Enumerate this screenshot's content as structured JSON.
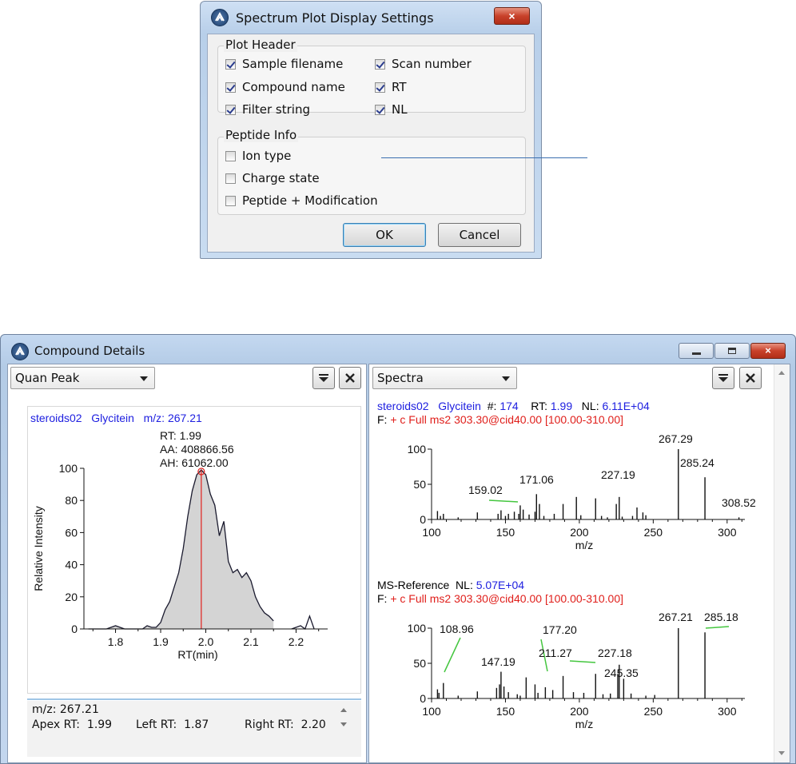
{
  "dialog": {
    "title": "Spectrum Plot Display Settings",
    "close_label": "×",
    "plot_header": {
      "label": "Plot Header",
      "items": [
        {
          "label": "Sample filename",
          "checked": true
        },
        {
          "label": "Scan number",
          "checked": true
        },
        {
          "label": "Compound name",
          "checked": true
        },
        {
          "label": "RT",
          "checked": true
        },
        {
          "label": "Filter string",
          "checked": true
        },
        {
          "label": "NL",
          "checked": true
        }
      ]
    },
    "peptide_info": {
      "label": "Peptide Info",
      "items": [
        {
          "label": "Ion type",
          "checked": false
        },
        {
          "label": "Charge state",
          "checked": false
        },
        {
          "label": "Peptide + Modification",
          "checked": false
        }
      ]
    },
    "ok_label": "OK",
    "cancel_label": "Cancel"
  },
  "window": {
    "title": "Compound Details",
    "left_pane": {
      "combo": "Quan Peak",
      "header": {
        "sample": "steroids02",
        "compound": "Glycitein",
        "mz_label": "m/z: 267.21"
      },
      "peak_labels": [
        "RT: 1.99",
        "AA: 408866.56",
        "AH: 61062.00"
      ],
      "footer": {
        "mz": "m/z: 267.21",
        "apex": "Apex RT:  1.99",
        "left": "Left RT:  1.87",
        "right": "Right RT:  2.20"
      }
    },
    "right_pane": {
      "combo": "Spectra",
      "header1": {
        "sample": "steroids02",
        "compound": "Glycitein",
        "scan_key": "#:",
        "scan": "174",
        "rt_key": "RT:",
        "rt": "1.99",
        "nl_key": "NL:",
        "nl": "6.11E+04"
      },
      "filter1": {
        "key": "F:",
        "value": "+ c Full ms2 303.30@cid40.00 [100.00-310.00]"
      },
      "header2": {
        "label": "MS-Reference",
        "nl_key": "NL:",
        "nl": "5.07E+04"
      },
      "filter2": {
        "key": "F:",
        "value": "+ c Full ms2 303.30@cid40.00 [100.00-310.00]"
      }
    }
  },
  "chart_data": [
    {
      "type": "area",
      "xlabel": "RT(min)",
      "ylabel": "Relative Intensity",
      "xlim": [
        1.73,
        2.27
      ],
      "ylim": [
        0,
        100
      ],
      "xticks": [
        1.8,
        1.9,
        2.0,
        2.1,
        2.2
      ],
      "yticks": [
        0,
        20,
        40,
        60,
        80,
        100
      ],
      "x": [
        1.74,
        1.76,
        1.78,
        1.8,
        1.82,
        1.84,
        1.86,
        1.87,
        1.88,
        1.89,
        1.9,
        1.91,
        1.92,
        1.93,
        1.94,
        1.95,
        1.96,
        1.97,
        1.98,
        1.99,
        2.0,
        2.01,
        2.02,
        2.03,
        2.04,
        2.05,
        2.06,
        2.07,
        2.08,
        2.09,
        2.1,
        2.11,
        2.12,
        2.13,
        2.14,
        2.15
      ],
      "y": [
        0,
        0,
        0,
        2,
        0,
        0,
        0,
        2,
        1,
        1,
        4,
        12,
        17,
        26,
        35,
        50,
        70,
        86,
        96,
        99,
        96,
        84,
        77,
        58,
        67,
        42,
        35,
        37,
        32,
        35,
        30,
        20,
        14,
        10,
        8,
        5
      ],
      "tail_x": [
        2.19,
        2.21,
        2.22,
        2.23,
        2.24
      ],
      "tail_y": [
        0,
        2,
        0,
        8,
        0
      ],
      "apex_rt": 1.99,
      "color": "#d4d4d4"
    },
    {
      "type": "bar",
      "xlabel": "m/z",
      "xlim": [
        100,
        312
      ],
      "ylim": [
        0,
        100
      ],
      "xticks": [
        100,
        150,
        200,
        250,
        300
      ],
      "yticks": [
        0,
        50,
        100
      ],
      "peaks": [
        [
          104,
          12
        ],
        [
          106,
          5
        ],
        [
          108,
          8
        ],
        [
          118,
          3
        ],
        [
          131,
          10
        ],
        [
          145,
          8
        ],
        [
          147,
          13
        ],
        [
          150,
          5
        ],
        [
          152,
          8
        ],
        [
          156,
          11
        ],
        [
          159,
          8
        ],
        [
          160,
          20
        ],
        [
          162,
          14
        ],
        [
          166,
          7
        ],
        [
          170,
          11
        ],
        [
          171,
          36
        ],
        [
          173,
          22
        ],
        [
          176,
          5
        ],
        [
          183,
          8
        ],
        [
          189,
          22
        ],
        [
          198,
          32
        ],
        [
          201,
          6
        ],
        [
          211,
          30
        ],
        [
          215,
          5
        ],
        [
          219,
          3
        ],
        [
          225,
          22
        ],
        [
          227,
          32
        ],
        [
          229,
          4
        ],
        [
          236,
          5
        ],
        [
          239,
          17
        ],
        [
          243,
          10
        ],
        [
          245,
          6
        ],
        [
          267,
          100
        ],
        [
          285,
          60
        ],
        [
          308,
          3
        ]
      ],
      "labels": [
        {
          "x": 159.02,
          "text": "159.02"
        },
        {
          "x": 171.06,
          "text": "171.06"
        },
        {
          "x": 227.19,
          "text": "227.19"
        },
        {
          "x": 267.29,
          "text": "267.29"
        },
        {
          "x": 285.24,
          "text": "285.24"
        },
        {
          "x": 308.52,
          "text": "308.52"
        }
      ]
    },
    {
      "type": "bar",
      "xlabel": "m/z",
      "xlim": [
        100,
        312
      ],
      "ylim": [
        0,
        100
      ],
      "xticks": [
        100,
        150,
        200,
        250,
        300
      ],
      "yticks": [
        0,
        50,
        100
      ],
      "peaks": [
        [
          104,
          13
        ],
        [
          105,
          8
        ],
        [
          108,
          22
        ],
        [
          118,
          4
        ],
        [
          131,
          10
        ],
        [
          144,
          15
        ],
        [
          146,
          20
        ],
        [
          147,
          38
        ],
        [
          149,
          17
        ],
        [
          152,
          9
        ],
        [
          158,
          6
        ],
        [
          160,
          4
        ],
        [
          164,
          30
        ],
        [
          170,
          20
        ],
        [
          172,
          8
        ],
        [
          177,
          16
        ],
        [
          182,
          12
        ],
        [
          189,
          32
        ],
        [
          196,
          9
        ],
        [
          203,
          8
        ],
        [
          211,
          35
        ],
        [
          216,
          6
        ],
        [
          221,
          7
        ],
        [
          226,
          35
        ],
        [
          227,
          48
        ],
        [
          230,
          28
        ],
        [
          235,
          7
        ],
        [
          245,
          4
        ],
        [
          251,
          5
        ],
        [
          267,
          100
        ],
        [
          285,
          94
        ]
      ],
      "labels": [
        {
          "x": 108.96,
          "text": "108.96"
        },
        {
          "x": 147.19,
          "text": "147.19"
        },
        {
          "x": 177.2,
          "text": "177.20"
        },
        {
          "x": 211.27,
          "text": "211.27"
        },
        {
          "x": 227.18,
          "text": "227.18"
        },
        {
          "x": 245.35,
          "text": "245.35"
        },
        {
          "x": 267.21,
          "text": "267.21"
        },
        {
          "x": 285.18,
          "text": "285.18"
        }
      ]
    }
  ]
}
